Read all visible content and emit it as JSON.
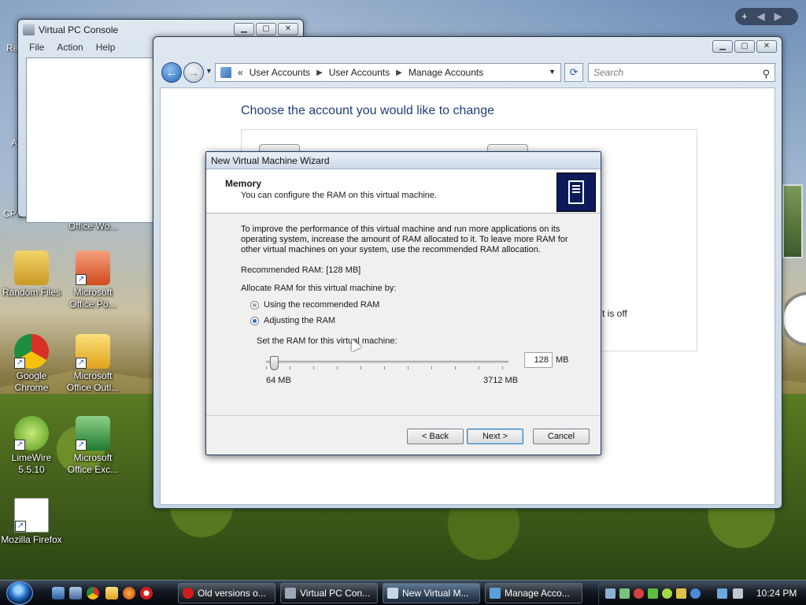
{
  "desktop": {
    "icons": [
      {
        "label": "Random Files"
      },
      {
        "label": "Microsoft Office Po..."
      },
      {
        "label": "Google Chrome"
      },
      {
        "label": "Microsoft Office Outl..."
      },
      {
        "label": "LimeWire 5.5.10"
      },
      {
        "label": "Microsoft Office Exc..."
      },
      {
        "label": "Mozilla Firefox"
      },
      {
        "label": "Office Wo..."
      }
    ],
    "partial_labels": [
      "Re",
      "A",
      "CPU"
    ]
  },
  "vpc_console": {
    "title": "Virtual PC Console",
    "menu": [
      "File",
      "Action",
      "Help"
    ]
  },
  "explorer": {
    "breadcrumb_prefix": "«",
    "breadcrumb": [
      "User Accounts",
      "User Accounts",
      "Manage Accounts"
    ],
    "search_placeholder": "Search",
    "heading": "Choose the account you would like to change",
    "account_status_partial": "t is off"
  },
  "wizard": {
    "title": "New Virtual Machine Wizard",
    "header_title": "Memory",
    "header_subtitle": "You can configure the RAM on this virtual machine.",
    "description": "To improve the performance of this virtual machine and run more applications on its operating system, increase the amount of RAM allocated to it. To leave more RAM for other virtual machines on your system, use the recommended RAM allocation.",
    "recommended": "Recommended RAM: [128 MB]",
    "allocate_label": "Allocate RAM for this virtual machine by:",
    "options": [
      {
        "label": "Using the recommended RAM",
        "selected": false
      },
      {
        "label": "Adjusting the RAM",
        "selected": true
      }
    ],
    "set_label": "Set the RAM for this virtual machine:",
    "ram_value": "128",
    "ram_unit": "MB",
    "ram_min": "64 MB",
    "ram_max": "3712 MB",
    "buttons": {
      "back": "< Back",
      "next": "Next >",
      "cancel": "Cancel"
    }
  },
  "taskbar": {
    "tasks": [
      {
        "label": "Old versions o...",
        "active": false,
        "icon_color": "#d21c1c"
      },
      {
        "label": "Virtual PC Con...",
        "active": false,
        "icon_color": "#9aa8b8"
      },
      {
        "label": "New Virtual M...",
        "active": true,
        "icon_color": "#c8d6e6"
      },
      {
        "label": "Manage Acco...",
        "active": false,
        "icon_color": "#5aa0d8"
      }
    ],
    "clock": "10:24 PM"
  },
  "colors": {
    "accent_blue": "#1e3f7a",
    "radio_selected": "#2a6fbf"
  }
}
